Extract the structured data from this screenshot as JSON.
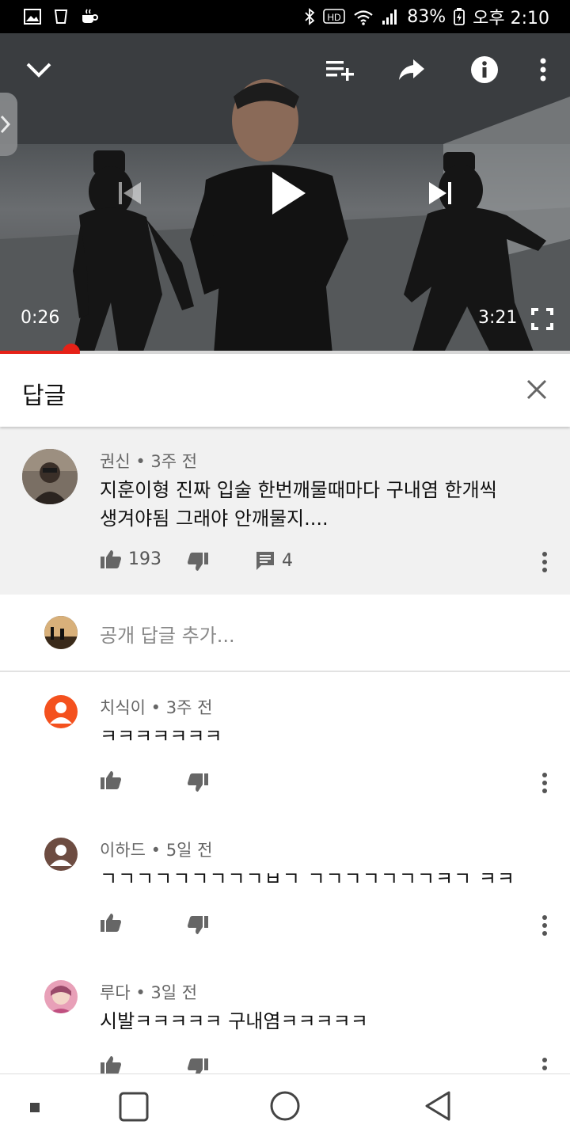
{
  "status_bar": {
    "battery": "83%",
    "time": "오후 2:10"
  },
  "player": {
    "current_time": "0:26",
    "duration": "3:21",
    "progress": 0.125
  },
  "replies_panel": {
    "title": "답글"
  },
  "main_comment": {
    "author": "권신",
    "age": "3주 전",
    "text_line1": "지훈이형 진짜 입술 한번깨물때마다 구내염 한개씩",
    "text_line2": "생겨야됨 그래야 안깨물지....",
    "likes": "193",
    "reply_count": "4"
  },
  "add_reply": {
    "placeholder": "공개 답글 추가..."
  },
  "replies": [
    {
      "author": "치식이",
      "age": "3주 전",
      "text": "ㅋㅋㅋㅋㅋㅋㅋ",
      "avatar_color": "#f4511e"
    },
    {
      "author": "이하드",
      "age": "5일 전",
      "text": "ㄱㄱㄱㄱㄱㄱㄱㄱㄱㅂㄱ ㄱㄱㄱㄱㄱㄱㄱㅋㄱ ㅋㅋ",
      "avatar_color": "#6d4c41"
    },
    {
      "author": "루다",
      "age": "3일 전",
      "text": "시발ㅋㅋㅋㅋㅋ 구내염ㅋㅋㅋㅋㅋ",
      "avatar_color": "#e8a0b8"
    }
  ],
  "colors": {
    "accent": "#e62117",
    "panel_bg": "#f1f1f1"
  }
}
